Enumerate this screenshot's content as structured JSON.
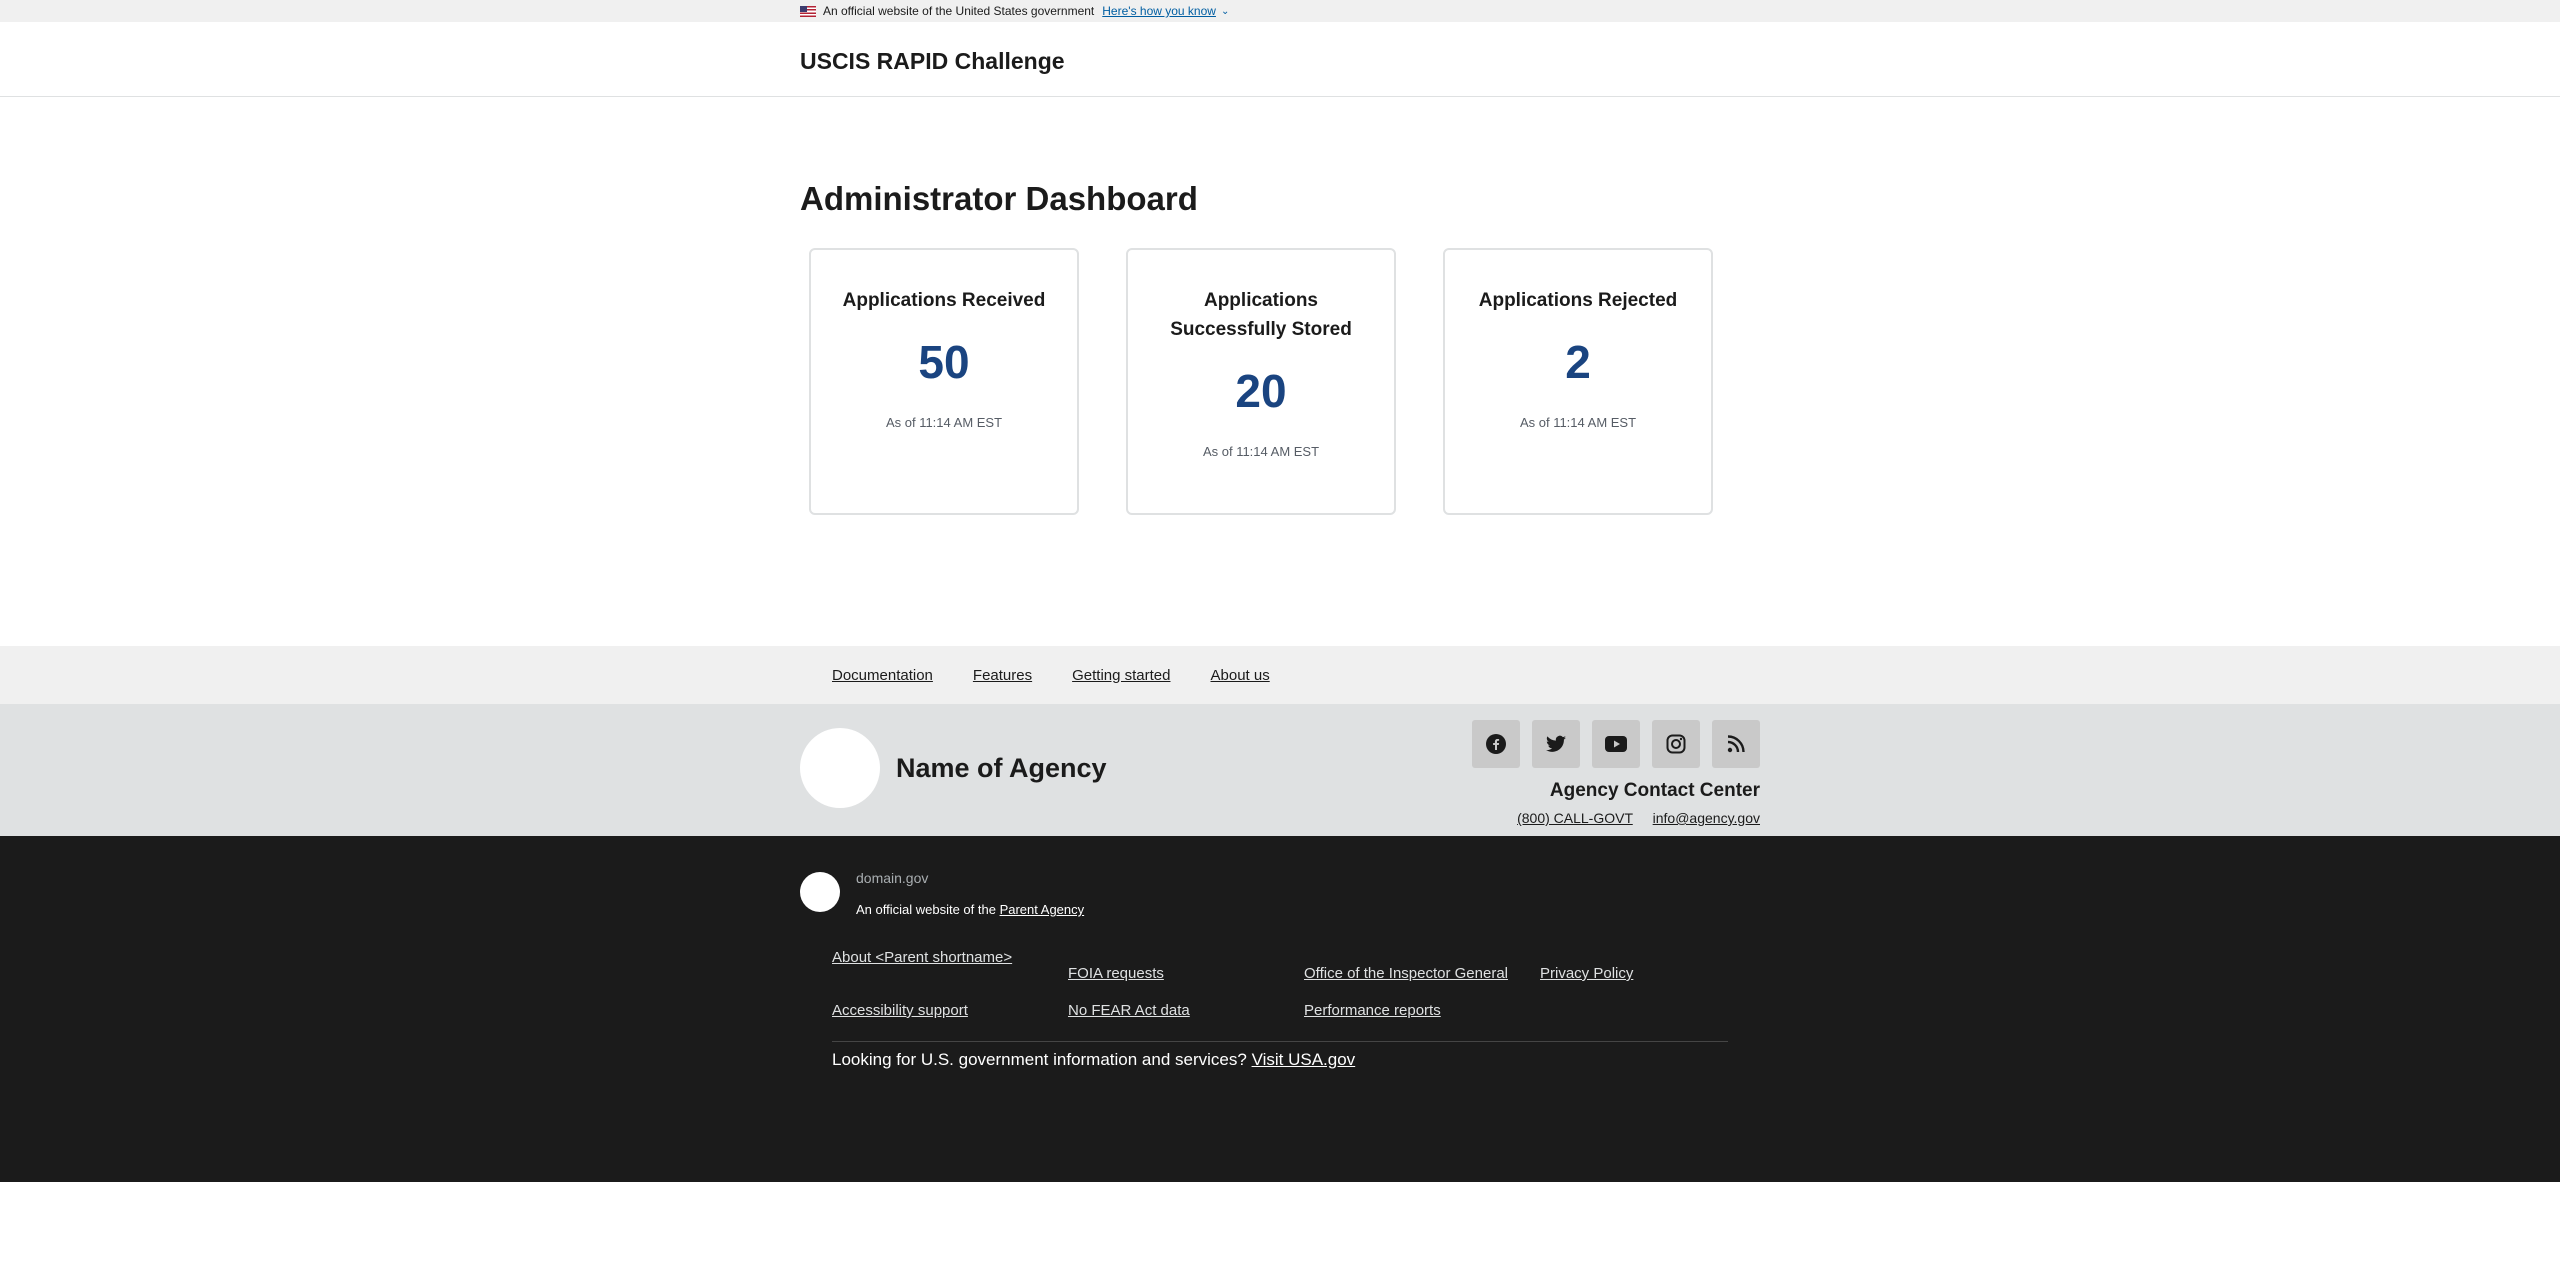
{
  "gov_banner": {
    "official_text": "An official website of the United States government",
    "how_link": "Here's how you know"
  },
  "header": {
    "site_title": "USCIS RAPID Challenge"
  },
  "main": {
    "page_title": "Administrator Dashboard",
    "cards": [
      {
        "title": "Applications Received",
        "value": "50",
        "timestamp": "As of 11:14 AM EST"
      },
      {
        "title": "Applications Successfully Stored",
        "value": "20",
        "timestamp": "As of 11:14 AM EST"
      },
      {
        "title": "Applications Rejected",
        "value": "2",
        "timestamp": "As of 11:14 AM EST"
      }
    ]
  },
  "footer_nav": {
    "links": [
      "Documentation",
      "Features",
      "Getting started",
      "About us"
    ]
  },
  "footer_secondary": {
    "agency_name": "Name of Agency",
    "socials": [
      "facebook-icon",
      "twitter-icon",
      "youtube-icon",
      "instagram-icon",
      "rss-icon"
    ],
    "contact_heading": "Agency Contact Center",
    "phone": "(800) CALL-GOVT",
    "email": "info@agency.gov"
  },
  "identifier": {
    "domain": "domain.gov",
    "desc_prefix": "An official website of the",
    "parent_agency": "Parent Agency",
    "links": [
      "About <Parent shortname>",
      "FOIA requests",
      "Office of the Inspector General",
      "Privacy Policy",
      "Accessibility support",
      "No FEAR Act data",
      "Performance reports"
    ],
    "usa_prefix": "Looking for U.S. government information and services?",
    "usa_link": "Visit USA.gov"
  },
  "colors": {
    "accent_value": "#1a4480",
    "link_blue": "#005ea2",
    "identifier_bg": "#1b1b1b"
  }
}
